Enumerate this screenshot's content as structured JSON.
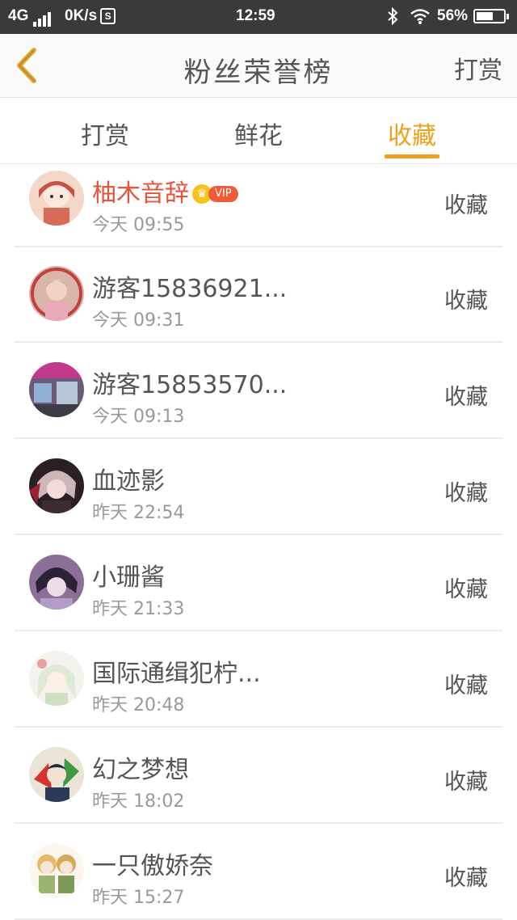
{
  "status_bar": {
    "network": "4G",
    "speed": "0K/s",
    "sim_badge": "S",
    "time": "12:59",
    "battery": "56%",
    "battery_level": 0.56
  },
  "nav": {
    "title": "粉丝荣誉榜",
    "action": "打赏"
  },
  "tabs": [
    {
      "label": "打赏",
      "active": false
    },
    {
      "label": "鲜花",
      "active": false
    },
    {
      "label": "收藏",
      "active": true
    }
  ],
  "accent_color": "#f0a01c",
  "list": [
    {
      "name": "柚木音辞",
      "time": "今天 09:55",
      "action": "收藏",
      "vip": true,
      "vip_label": "VIP"
    },
    {
      "name": "游客15836921...",
      "time": "今天 09:31",
      "action": "收藏"
    },
    {
      "name": "游客15853570...",
      "time": "今天 09:13",
      "action": "收藏"
    },
    {
      "name": "血迹影",
      "time": "昨天 22:54",
      "action": "收藏"
    },
    {
      "name": "小珊酱",
      "time": "昨天 21:33",
      "action": "收藏"
    },
    {
      "name": "国际通缉犯柠...",
      "time": "昨天 20:48",
      "action": "收藏"
    },
    {
      "name": "幻之梦想",
      "time": "昨天 18:02",
      "action": "收藏"
    },
    {
      "name": "一只傲娇奈",
      "time": "昨天 15:27",
      "action": "收藏"
    }
  ]
}
